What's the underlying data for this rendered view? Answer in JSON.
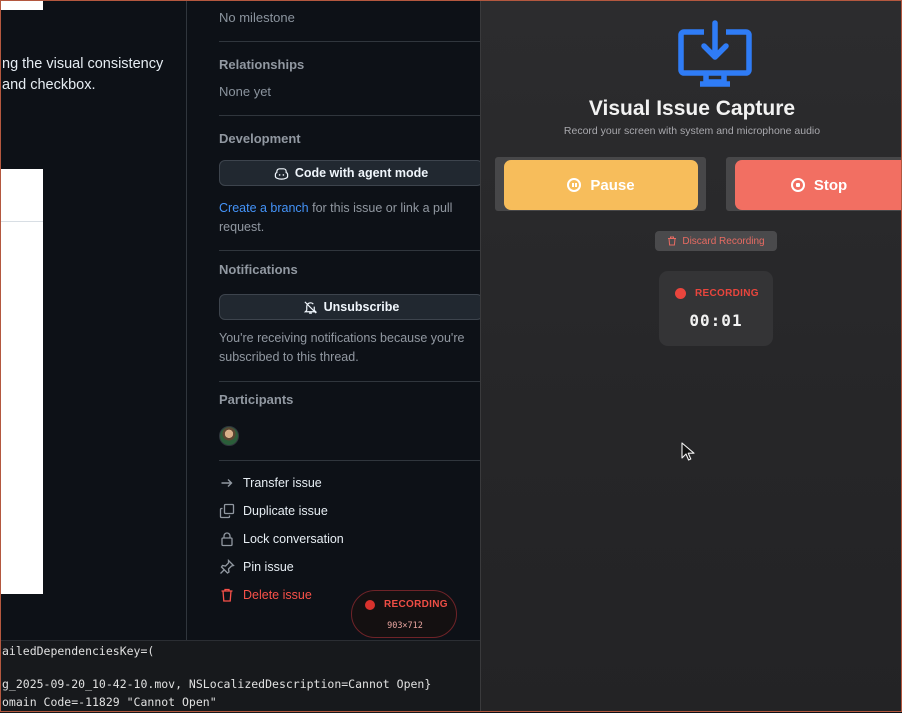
{
  "issue": {
    "description_lines": [
      "ng the visual consistency",
      "and checkbox."
    ]
  },
  "sidebar": {
    "milestone_value": "No milestone",
    "relationships": {
      "heading": "Relationships",
      "value": "None yet"
    },
    "development": {
      "heading": "Development",
      "agent_button_label": "Code with agent mode",
      "branch_link": "Create a branch",
      "branch_text_1": " for this issue or link a pull",
      "branch_text_2": "request."
    },
    "notifications": {
      "heading": "Notifications",
      "unsubscribe_label": "Unsubscribe",
      "note_line_1": "You're receiving notifications because you're",
      "note_line_2": "subscribed to this thread."
    },
    "participants": {
      "heading": "Participants"
    },
    "actions": [
      {
        "label": "Transfer issue",
        "icon": "arrow-right-icon"
      },
      {
        "label": "Duplicate issue",
        "icon": "copy-icon"
      },
      {
        "label": "Lock conversation",
        "icon": "lock-icon"
      },
      {
        "label": "Pin issue",
        "icon": "pin-icon"
      },
      {
        "label": "Delete issue",
        "icon": "trash-icon"
      }
    ]
  },
  "terminal": {
    "lines": [
      "ailedDependenciesKey=(",
      "",
      "g_2025-09-20_10-42-10.mov, NSLocalizedDescription=Cannot Open}",
      "omain Code=-11829 \"Cannot Open\""
    ]
  },
  "recording_pill": {
    "label": "RECORDING",
    "dimensions": "903×712"
  },
  "capture": {
    "title": "Visual Issue Capture",
    "subtitle": "Record your screen with system and microphone audio",
    "pause_label": "Pause",
    "stop_label": "Stop",
    "discard_label": "Discard Recording",
    "status_label": "RECORDING",
    "elapsed": "00:01"
  },
  "colors": {
    "pause": "#f7bd5b",
    "stop": "#f26f62",
    "recording_red": "#e9453d",
    "link_blue": "#4493f8",
    "icon_blue": "#2f7cf6"
  }
}
